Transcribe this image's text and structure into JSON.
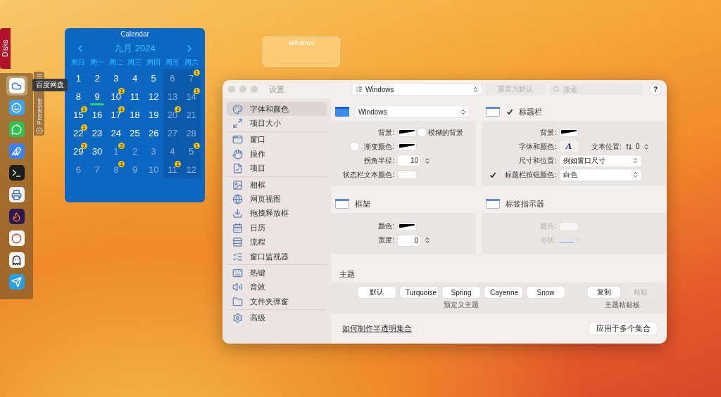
{
  "desktop": {
    "disks_tab": {
      "label": "Disks"
    },
    "dock": {
      "apps": [
        {
          "kind": "cloud",
          "selected": true
        },
        {
          "kind": "finder",
          "selected": false
        },
        {
          "kind": "chat",
          "selected": false
        },
        {
          "kind": "bird",
          "selected": false
        },
        {
          "kind": "terminal",
          "selected": false
        },
        {
          "kind": "printer",
          "selected": false
        },
        {
          "kind": "fox",
          "selected": false
        },
        {
          "kind": "chrome",
          "selected": false
        },
        {
          "kind": "penguin",
          "selected": false
        },
        {
          "kind": "plane",
          "selected": false
        }
      ],
      "tooltip": "百度网盘"
    },
    "processes_tab": {
      "label": "Processe"
    },
    "calendar": {
      "title": "Calendar",
      "month": "九月 2024",
      "weekdays": [
        {
          "label": "周日",
          "shaded": false
        },
        {
          "label": "周一",
          "shaded": false
        },
        {
          "label": "周二",
          "shaded": false
        },
        {
          "label": "周三",
          "shaded": false
        },
        {
          "label": "周四",
          "shaded": false
        },
        {
          "label": "周五",
          "shaded": true
        },
        {
          "label": "周六",
          "shaded": true
        }
      ],
      "weeks": [
        {
          "days": [
            {
              "day": "1",
              "muted": false,
              "today": false
            },
            {
              "day": "2",
              "muted": false,
              "today": false
            },
            {
              "day": "3",
              "muted": false,
              "today": false
            },
            {
              "day": "4",
              "muted": false,
              "today": false
            },
            {
              "day": "5",
              "muted": false,
              "today": false
            },
            {
              "day": "6",
              "muted": true,
              "today": false
            },
            {
              "day": "7",
              "muted": true,
              "today": false,
              "badge": "1"
            }
          ]
        },
        {
          "days": [
            {
              "day": "8",
              "muted": false,
              "today": false
            },
            {
              "day": "9",
              "muted": false,
              "today": true
            },
            {
              "day": "10",
              "muted": false,
              "today": false,
              "badge": "1"
            },
            {
              "day": "11",
              "muted": false,
              "today": false
            },
            {
              "day": "12",
              "muted": false,
              "today": false
            },
            {
              "day": "13",
              "muted": true,
              "today": false
            },
            {
              "day": "14",
              "muted": true,
              "today": false,
              "badge": "1"
            }
          ]
        },
        {
          "days": [
            {
              "day": "15",
              "muted": false,
              "today": false,
              "badge": "1"
            },
            {
              "day": "16",
              "muted": false,
              "today": false
            },
            {
              "day": "17",
              "muted": false,
              "today": false,
              "badge": "1"
            },
            {
              "day": "18",
              "muted": false,
              "today": false
            },
            {
              "day": "19",
              "muted": false,
              "today": false
            },
            {
              "day": "20",
              "muted": true,
              "today": false,
              "badge": "2"
            },
            {
              "day": "21",
              "muted": true,
              "today": false
            }
          ]
        },
        {
          "days": [
            {
              "day": "22",
              "muted": false,
              "today": false,
              "badge": "1"
            },
            {
              "day": "23",
              "muted": false,
              "today": false
            },
            {
              "day": "24",
              "muted": false,
              "today": false
            },
            {
              "day": "25",
              "muted": false,
              "today": false
            },
            {
              "day": "26",
              "muted": false,
              "today": false
            },
            {
              "day": "27",
              "muted": true,
              "today": false
            },
            {
              "day": "28",
              "muted": true,
              "today": false
            }
          ]
        },
        {
          "days": [
            {
              "day": "29",
              "muted": false,
              "today": false,
              "badge": "1"
            },
            {
              "day": "30",
              "muted": false,
              "today": false
            },
            {
              "day": "1",
              "muted": true,
              "today": false,
              "badge": "2"
            },
            {
              "day": "2",
              "muted": true,
              "today": false
            },
            {
              "day": "3",
              "muted": true,
              "today": false
            },
            {
              "day": "4",
              "muted": true,
              "today": false
            },
            {
              "day": "5",
              "muted": true,
              "today": false,
              "badge": "1"
            }
          ]
        },
        {
          "days": [
            {
              "day": "6",
              "muted": true,
              "today": false
            },
            {
              "day": "7",
              "muted": true,
              "today": false
            },
            {
              "day": "8",
              "muted": true,
              "today": false,
              "badge": "1"
            },
            {
              "day": "9",
              "muted": true,
              "today": false
            },
            {
              "day": "10",
              "muted": true,
              "today": false
            },
            {
              "day": "11",
              "muted": true,
              "today": false,
              "badge": "1"
            },
            {
              "day": "12",
              "muted": true,
              "today": false
            }
          ]
        }
      ]
    },
    "windows_widget": {
      "label": "Windows"
    },
    "settings": {
      "title": "设置",
      "collection_select": "Windows",
      "reset_button": {
        "label": "重置为默认",
        "disabled": true
      },
      "search": {
        "placeholder": "搜索"
      },
      "help": "?",
      "sidebar": {
        "groups": [
          {
            "items": [
              {
                "label": "字体和颜色",
                "kind": "palette",
                "selected": true
              },
              {
                "label": "项目大小",
                "kind": "resize",
                "selected": false
              }
            ]
          },
          {
            "items": [
              {
                "label": "窗口",
                "kind": "window",
                "selected": false
              },
              {
                "label": "操作",
                "kind": "hand",
                "selected": false
              },
              {
                "label": "项目",
                "kind": "file",
                "selected": false
              }
            ]
          },
          {
            "items": [
              {
                "label": "相框",
                "kind": "image",
                "selected": false
              },
              {
                "label": "网页视图",
                "kind": "globe",
                "selected": false
              },
              {
                "label": "拖拽释放框",
                "kind": "download",
                "selected": false
              },
              {
                "label": "日历",
                "kind": "calendar",
                "selected": false
              },
              {
                "label": "流程",
                "kind": "rows",
                "selected": false
              },
              {
                "label": "窗口监视器",
                "kind": "list",
                "selected": false
              }
            ]
          },
          {
            "items": [
              {
                "label": "热键",
                "kind": "keyboard",
                "selected": false
              },
              {
                "label": "音效",
                "kind": "speaker",
                "selected": false
              },
              {
                "label": "文件夹弹窗",
                "kind": "folder",
                "selected": false
              }
            ]
          },
          {
            "items": [
              {
                "label": "高级",
                "kind": "gear",
                "selected": false
              }
            ]
          }
        ]
      },
      "window_section": {
        "style_select": "Windows",
        "background": {
          "label": "背景:",
          "blur": {
            "label": "模糊的背景",
            "checked": false
          }
        },
        "gradient": {
          "label": "渐变颜色:",
          "checked": false
        },
        "corner_radius": {
          "label": "拐角半径:",
          "value": "10"
        },
        "status_text_color": {
          "label": "状态栏文本颜色:"
        }
      },
      "frame_section": {
        "title": "框架",
        "color": {
          "label": "颜色:"
        },
        "width": {
          "label": "宽度:",
          "value": "0"
        }
      },
      "titlebar_section": {
        "title": "标题栏",
        "checked": true,
        "background": {
          "label": "背景:"
        },
        "font": {
          "label": "字体和颜色:",
          "sample": "A"
        },
        "text_position": {
          "label": "文本位置:",
          "value": "0"
        },
        "size_position": {
          "label": "尺寸和位置:",
          "value": "例如窗口尺寸"
        },
        "button_color": {
          "label": "标题栏按钮颜色:",
          "checked": true,
          "value": "白色"
        }
      },
      "tab_indicator_section": {
        "title": "标签指示器",
        "disabled": true,
        "color": {
          "label": "颜色:"
        },
        "shape": {
          "label": "形状:"
        }
      },
      "theme_section": {
        "title": "主题",
        "presets": {
          "buttons": [
            "默认",
            "Turquoise",
            "Spring",
            "Cayenne",
            "Snow"
          ],
          "caption": "预定义主题"
        },
        "clipboard": {
          "buttons": [
            {
              "label": "复制",
              "disabled": false
            },
            {
              "label": "粘贴",
              "disabled": true
            }
          ],
          "caption": "主题粘贴板"
        }
      },
      "footer": {
        "link": "如何制作半透明集合",
        "apply_button": "应用于多个集合"
      }
    }
  }
}
